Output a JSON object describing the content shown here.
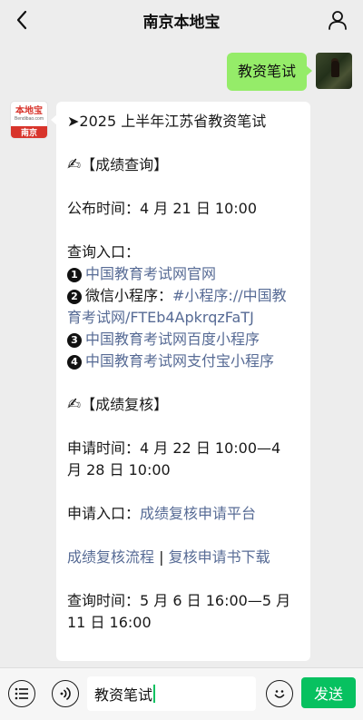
{
  "header": {
    "title": "南京本地宝"
  },
  "outgoing": {
    "text": "教资笔试"
  },
  "bot_avatar": {
    "logo_text": "本地宝",
    "logo_url": "Bendibao.com",
    "city": "南京"
  },
  "message": {
    "headline": "➤2025 上半年江苏省教资笔试",
    "sec1_icon": "✍",
    "sec1_title": "【成绩查询】",
    "publish_label": "公布时间：",
    "publish_value": "4 月 21 日 10:00",
    "entry_label": "查询入口：",
    "entries": [
      {
        "num": "1",
        "prefix": "",
        "link": "中国教育考试网官网"
      },
      {
        "num": "2",
        "prefix": "微信小程序：",
        "link": "#小程序://中国教育考试网/FTEb4ApkrqzFaTJ"
      },
      {
        "num": "3",
        "prefix": "",
        "link": "中国教育考试网百度小程序"
      },
      {
        "num": "4",
        "prefix": "",
        "link": "中国教育考试网支付宝小程序"
      }
    ],
    "sec2_icon": "✍",
    "sec2_title": "【成绩复核】",
    "apply_time_label": "申请时间：",
    "apply_time_value": "4 月 22 日 10:00—4 月 28 日 10:00",
    "apply_entry_label": "申请入口：",
    "apply_entry_link": "成绩复核申请平台",
    "process_link": "成绩复核流程",
    "separator": " | ",
    "download_link": "复核申请书下载",
    "query_time_label": "查询时间：",
    "query_time_value": "5 月 6 日 16:00—5 月 11 日 16:00"
  },
  "input": {
    "value": "教资笔试"
  },
  "send_button": {
    "label": "发送"
  },
  "icons": [
    "back-arrow-icon",
    "user-icon",
    "menu-list-icon",
    "voice-icon",
    "emoji-icon"
  ]
}
